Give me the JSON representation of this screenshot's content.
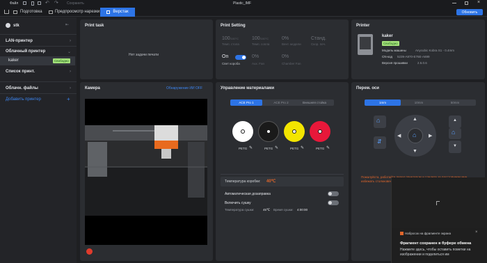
{
  "titlebar": {
    "file_menu": "Файл",
    "title": "Plastic_IMF",
    "save_hint": "Сохранить"
  },
  "tabs": {
    "prepare": "Подготовка",
    "preview": "Предпросмотр нарезки",
    "device": "Верстак",
    "update": "Обновить"
  },
  "sidebar": {
    "user": "stk",
    "lan_printer": "LAN-принтер",
    "cloud_printer": "Облачный принтер",
    "printer_name": "kaker",
    "printer_status": "Свободно",
    "print_list": "Список принт.",
    "cloud_files": "Облачн. файлы",
    "add_printer": "Добавить принтер"
  },
  "print_task": {
    "title": "Print task",
    "empty": "Нет задачи печати"
  },
  "print_setting": {
    "title": "Print Setting",
    "temps": [
      {
        "value": "100",
        "unit": "/100°C",
        "label": "Темп. стола"
      },
      {
        "value": "100",
        "unit": "/100°C",
        "label": "Темп. сопла"
      },
      {
        "value": "0%",
        "unit": "",
        "label": "Вент. модели"
      },
      {
        "value": "Станд.",
        "unit": "",
        "label": "Скор. печ."
      }
    ],
    "light_label": "On",
    "light_caption": "Свет короба",
    "aux_value": "0%",
    "aux_label": "Aux. Fan",
    "chamber_value": "0%",
    "chamber_label": "Chamber Fan"
  },
  "printer": {
    "title": "Printer",
    "name": "kaker",
    "status": "Свободно",
    "model_label": "Модель машины",
    "model_value": "Anycubic Kobra S1 - 0.4mm",
    "sn_label": "CN-код",
    "sn_value": "5239-A870-E76E-A699",
    "fw_label": "Версия прошивки",
    "fw_value": "2.5.0.6"
  },
  "camera": {
    "title": "Камера",
    "detect_link": "Обнаружение ИИ OFF"
  },
  "materials": {
    "title": "Управление материалами",
    "tabs": [
      "ACE Pro 1",
      "ACE Pro 2",
      "Внешняя стойка"
    ],
    "spools": [
      {
        "type": "PETG",
        "color": "#ffffff"
      },
      {
        "type": "PETG",
        "color": "#1a1a1a"
      },
      {
        "type": "PETG",
        "color": "#f3e500"
      },
      {
        "type": "PETG",
        "color": "#e8183a"
      }
    ],
    "box_temp_label": "Температура коробки:",
    "box_temp_value": "40℃",
    "auto_refill": "Автоматическая дозаправка",
    "drying": "Включить сушку",
    "dry_temp_label": "Температура сушки:",
    "dry_temp_value": "45℃",
    "dry_time_label": "Время сушки:",
    "dry_time_value": "4:00:00"
  },
  "axis": {
    "title": "Перем. оси",
    "steps": [
      "1mm",
      "10mm",
      "50mm"
    ],
    "warning": "Пожалуйста, работайте перед принтером и следите за расстоянием мин. избежать столкновения",
    "accent": "#2d74e6",
    "warn_color": "#e0662b"
  },
  "toast": {
    "app": "Набросок на фрагменте экрана",
    "title": "Фрагмент сохранен в буфере обмена",
    "body": "Нажмите здесь, чтобы оставить пометки на изображении и поделиться им"
  }
}
